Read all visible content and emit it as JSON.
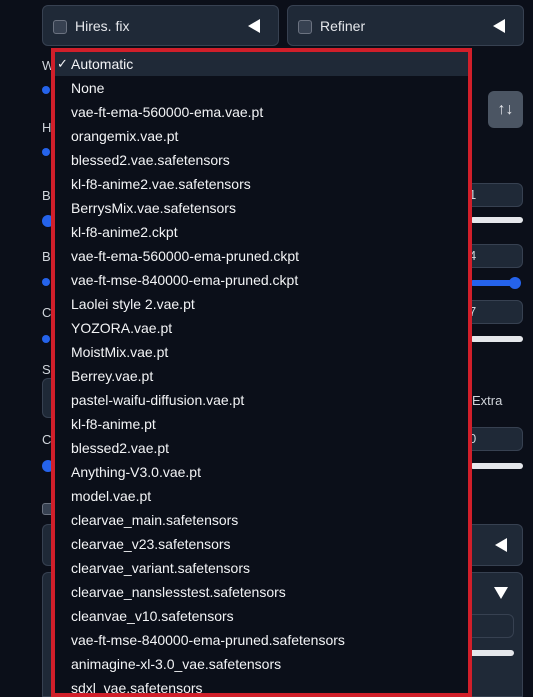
{
  "top": {
    "hires_label": "Hires. fix",
    "refiner_label": "Refiner"
  },
  "partial_labels": {
    "width": "W",
    "height": "H",
    "batch_count": "B",
    "batch_size": "B",
    "cfg": "C",
    "seed": "S",
    "c2": "C",
    "extra": "Extra"
  },
  "partial_values": {
    "v1": "1",
    "v2": "4",
    "v3": "7",
    "v4": "0"
  },
  "swap_icon": "↑↓",
  "vae_dropdown": {
    "selected": "Automatic",
    "check_glyph": "✓",
    "options": [
      "Automatic",
      "None",
      "vae-ft-ema-560000-ema.vae.pt",
      "orangemix.vae.pt",
      "blessed2.vae.safetensors",
      "kl-f8-anime2.vae.safetensors",
      "BerrysMix.vae.safetensors",
      "kl-f8-anime2.ckpt",
      "vae-ft-ema-560000-ema-pruned.ckpt",
      "vae-ft-mse-840000-ema-pruned.ckpt",
      "Laolei style 2.vae.pt",
      "YOZORA.vae.pt",
      "MoistMix.vae.pt",
      "Berrey.vae.pt",
      "pastel-waifu-diffusion.vae.pt",
      "kl-f8-anime.pt",
      "blessed2.vae.pt",
      "Anything-V3.0.vae.pt",
      "model.vae.pt",
      "clearvae_main.safetensors",
      "clearvae_v23.safetensors",
      "clearvae_variant.safetensors",
      "clearvae_nanslesstest.safetensors",
      "cleanvae_v10.safetensors",
      "vae-ft-mse-840000-ema-pruned.safetensors",
      "animagine-xl-3.0_vae.safetensors",
      "sdxl_vae.safetensors"
    ]
  },
  "colors": {
    "background": "#0b0f19",
    "accent": "#2563eb",
    "highlight_border": "#d11f2a"
  }
}
